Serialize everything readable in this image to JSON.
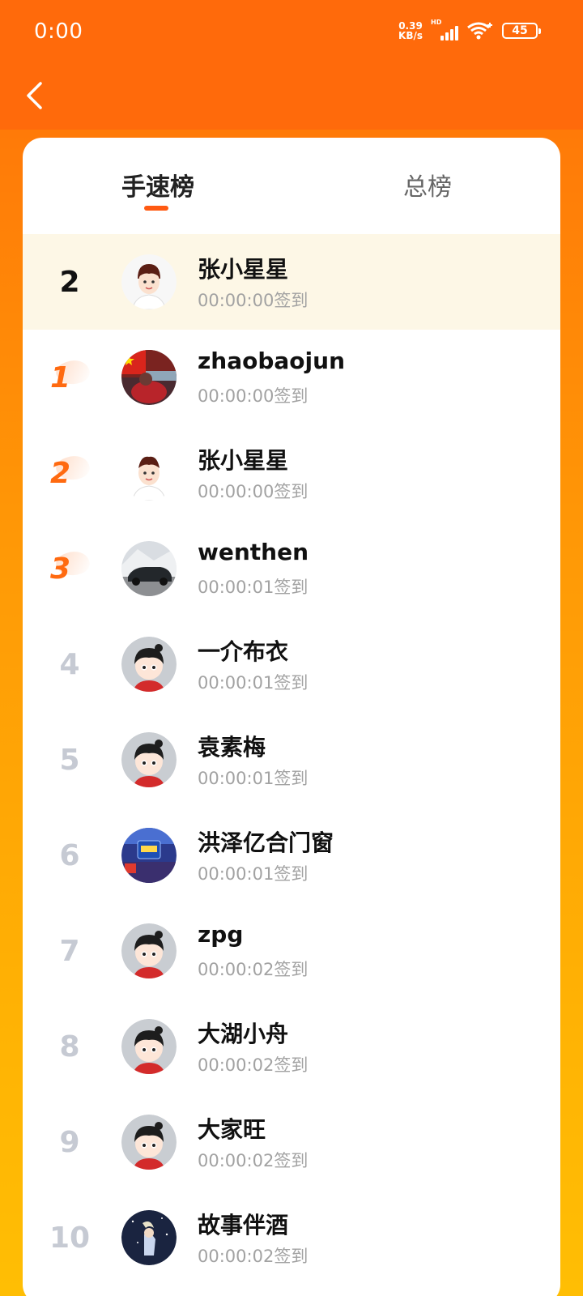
{
  "status_bar": {
    "time": "0:00",
    "net_speed_value": "0.39",
    "net_speed_unit": "KB/s",
    "signal_label": "HD",
    "battery": "45"
  },
  "nav": {
    "back_icon": "chevron-left-icon"
  },
  "tabs": [
    {
      "label": "手速榜",
      "active": true
    },
    {
      "label": "总榜",
      "active": false
    }
  ],
  "my_row": {
    "rank": "2",
    "name": "张小星星",
    "time": "00:00:00签到"
  },
  "ranking": [
    {
      "rank": "1",
      "name": "zhaobaojun",
      "time": "00:00:00签到"
    },
    {
      "rank": "2",
      "name": "张小星星",
      "time": "00:00:00签到"
    },
    {
      "rank": "3",
      "name": "wenthen",
      "time": "00:00:01签到"
    },
    {
      "rank": "4",
      "name": "一介布衣",
      "time": "00:00:01签到"
    },
    {
      "rank": "5",
      "name": "袁素梅",
      "time": "00:00:01签到"
    },
    {
      "rank": "6",
      "name": "洪泽亿合门窗",
      "time": "00:00:01签到"
    },
    {
      "rank": "7",
      "name": "zpg",
      "time": "00:00:02签到"
    },
    {
      "rank": "8",
      "name": "大湖小舟",
      "time": "00:00:02签到"
    },
    {
      "rank": "9",
      "name": "大家旺",
      "time": "00:00:02签到"
    },
    {
      "rank": "10",
      "name": "故事伴酒",
      "time": "00:00:02签到"
    }
  ],
  "colors": {
    "header": "#ff6a0b",
    "accent": "#ff5a12",
    "top_rank": "#ff6a10",
    "my_row_bg": "#fdf7e6"
  }
}
